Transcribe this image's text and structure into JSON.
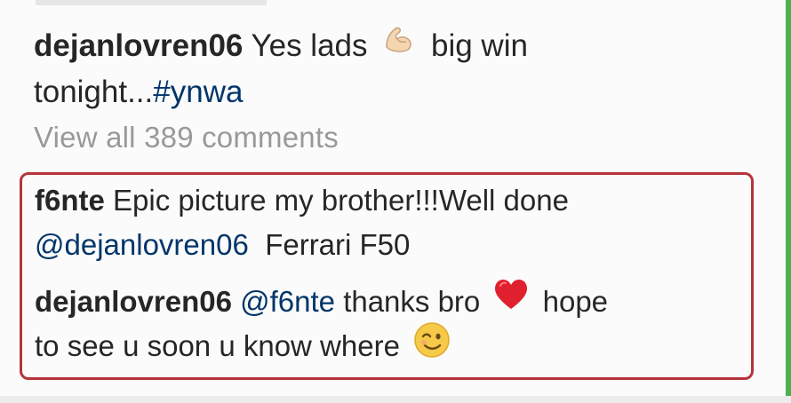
{
  "post": {
    "username": "dejanlovren06",
    "caption_part1": "Yes lads",
    "caption_part2": "big win",
    "caption_part3": "tonight...",
    "hashtag": "#ynwa",
    "view_all_comments": "View all 389 comments"
  },
  "comments": [
    {
      "username": "f6nte",
      "text_part1": "Epic picture my brother!!!Well done",
      "mention": "@dejanlovren06",
      "text_part2": "Ferrari F50"
    },
    {
      "username": "dejanlovren06",
      "mention": "@f6nte",
      "text_part1": "thanks bro",
      "text_part2": "hope",
      "text_part3": "to see u soon u know where"
    }
  ],
  "icons": {
    "flexed_biceps": "flexed-biceps-emoji",
    "red_heart": "red-heart-emoji",
    "winking_face": "winking-face-emoji"
  },
  "colors": {
    "text": "#262626",
    "mention": "#003569",
    "muted": "#999999",
    "highlight_border": "#b5353a"
  }
}
